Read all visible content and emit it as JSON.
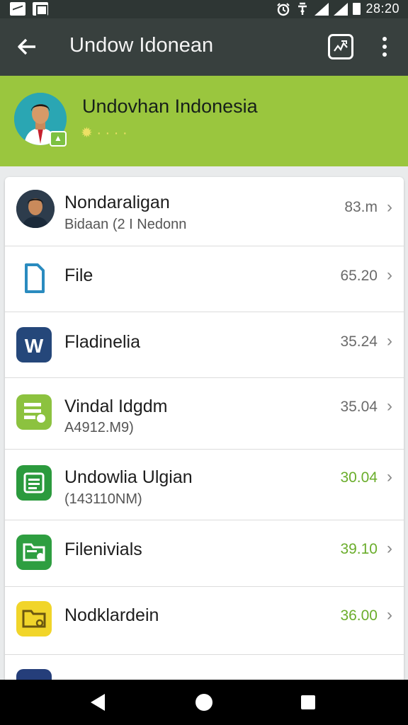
{
  "status_bar": {
    "time": "28:20",
    "icons": [
      "signal-chart-icon",
      "square-icon",
      "alarm-icon",
      "wifi-icon",
      "cell-signal-icon",
      "cell-signal-icon",
      "battery-icon"
    ]
  },
  "app_bar": {
    "back_icon": "arrow-left-icon",
    "title": "Undow Idonean",
    "action_icon": "chart-icon",
    "more_icon": "more-vert-icon"
  },
  "profile": {
    "name": "Undovhan Indonesia",
    "accent": "#9ac63e"
  },
  "rows": [
    {
      "icon": "avatar",
      "title": "Nondaraligan",
      "subtitle": "Bidaan (2 I Nedonn",
      "value": "83.m",
      "value_color": "#6a6a6a"
    },
    {
      "icon": "file-icon",
      "title": "File",
      "subtitle": "",
      "value": "65.20",
      "value_color": "#6a6a6a"
    },
    {
      "icon": "w-document-icon",
      "title": "Fladinelia",
      "subtitle": "",
      "value": "35.24",
      "value_color": "#6a6a6a"
    },
    {
      "icon": "spreadsheet-icon",
      "title": "Vindal Idgdm",
      "subtitle": "A4912.M9)",
      "value": "35.04",
      "value_color": "#6a6a6a"
    },
    {
      "icon": "document-lines-icon",
      "title": "Undowlia Ulgian",
      "subtitle": "(143110NM)",
      "value": "30.04",
      "value_color": "#6aad2b"
    },
    {
      "icon": "folder-search-icon",
      "title": "Filenivials",
      "subtitle": "",
      "value": "39.10",
      "value_color": "#6aad2b"
    },
    {
      "icon": "folder-icon",
      "title": "Nodklardein",
      "subtitle": "",
      "value": "36.00",
      "value_color": "#6aad2b"
    }
  ],
  "colors": {
    "app_bar": "#38403e",
    "profile_bg": "#9ac63e",
    "value_green": "#6aad2b"
  },
  "nav": {
    "back_icon": "nav-back-icon",
    "home_icon": "nav-home-icon",
    "recents_icon": "nav-recents-icon"
  }
}
